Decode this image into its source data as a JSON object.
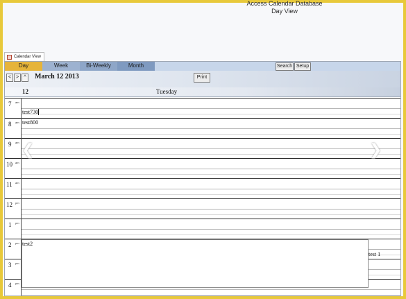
{
  "app": {
    "title_line1": "Access Calendar Database",
    "title_line2": "Day View"
  },
  "document_tab": {
    "label": "Calendar View",
    "icon": "form-icon"
  },
  "view_tabs": [
    "Day",
    "Week",
    "Bi-Weekly",
    "Month"
  ],
  "toolbar": {
    "search_label": "Search",
    "setup_label": "Setup",
    "prev_label": "<",
    "next_label": ">",
    "up_label": "^",
    "date": "March 12 2013",
    "print_label": "Print"
  },
  "day_header": {
    "day_number": "12",
    "day_name": "Tuesday"
  },
  "hours": [
    {
      "h": "7",
      "ap": "am"
    },
    {
      "h": "8",
      "ap": "am"
    },
    {
      "h": "9",
      "ap": "am"
    },
    {
      "h": "10",
      "ap": "am"
    },
    {
      "h": "11",
      "ap": "am"
    },
    {
      "h": "12",
      "ap": "pm"
    },
    {
      "h": "1",
      "ap": "pm"
    },
    {
      "h": "2",
      "ap": "pm"
    },
    {
      "h": "3",
      "ap": "pm"
    },
    {
      "h": "4",
      "ap": "pm"
    }
  ],
  "events": [
    {
      "title": "test730"
    },
    {
      "title": "test800"
    },
    {
      "title": "test2"
    },
    {
      "title": "test 1"
    }
  ],
  "colors": {
    "frame": "#e8c93a",
    "active_tab": "#e6b43a",
    "tab_bar": "#c7d6ea"
  }
}
